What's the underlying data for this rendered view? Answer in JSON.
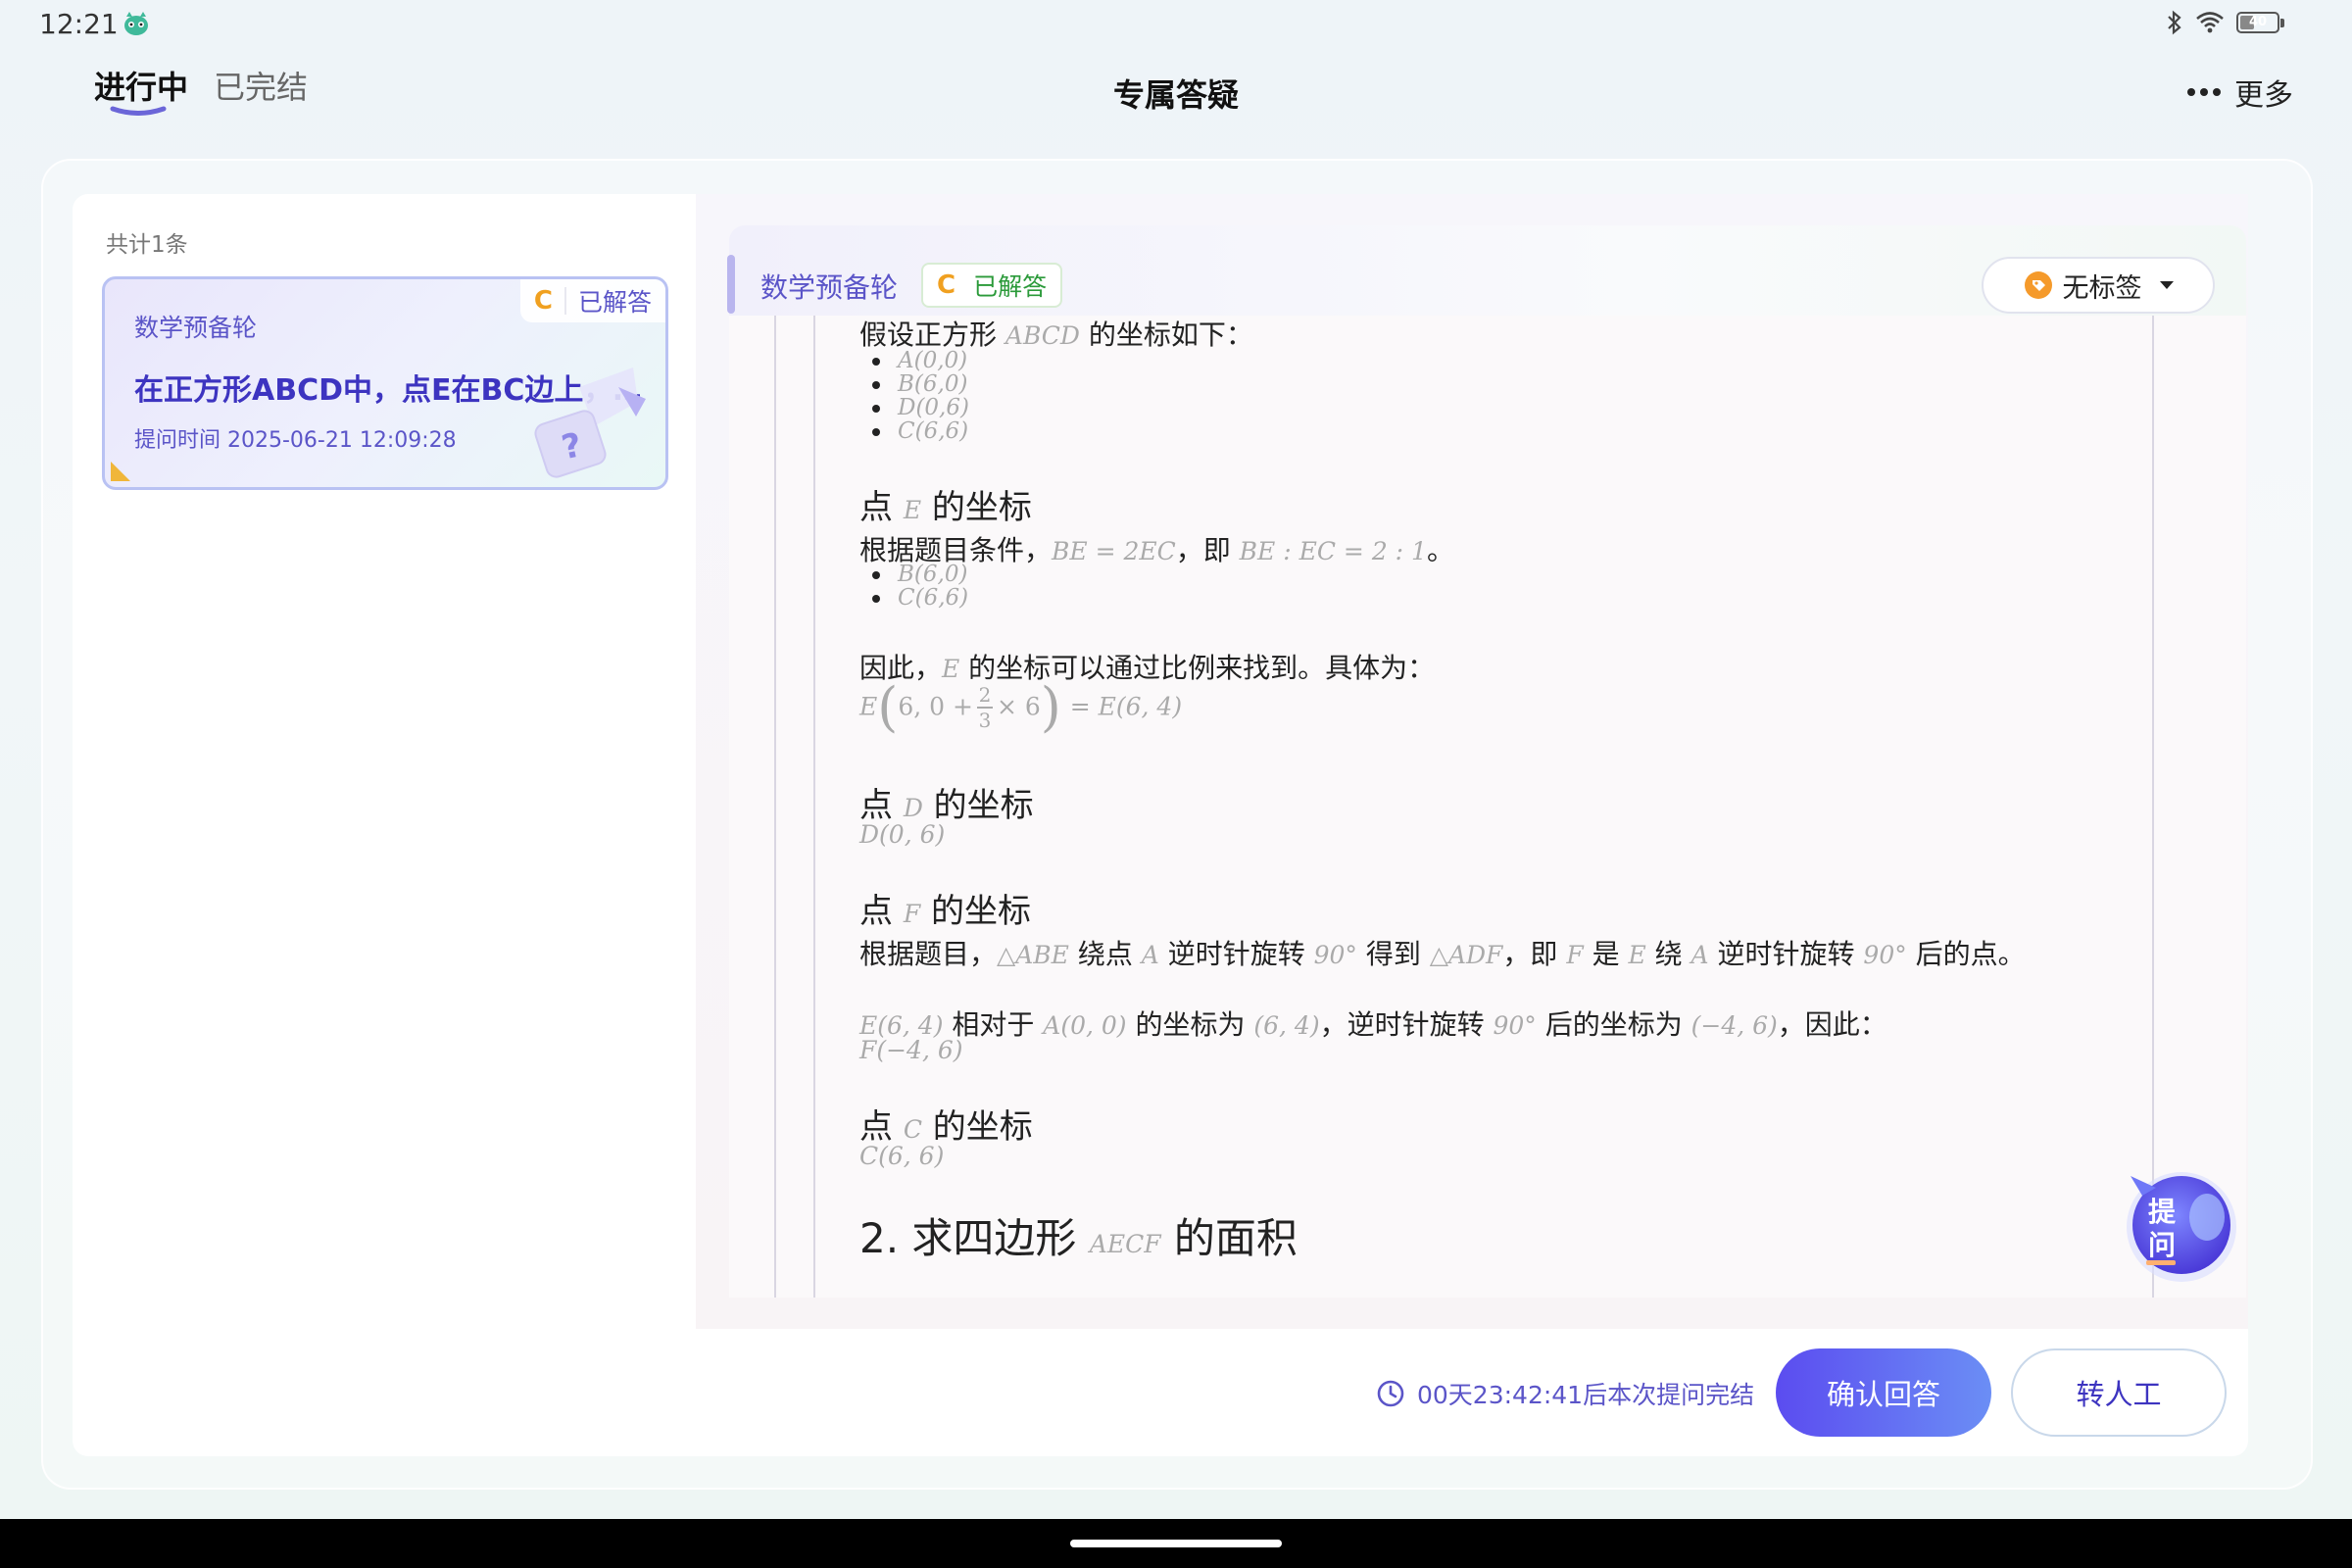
{
  "status_bar": {
    "time": "12:21",
    "battery": "40",
    "battery_level": 0.4
  },
  "header": {
    "tabs": [
      {
        "label": "进行中",
        "active": true
      },
      {
        "label": "已完结",
        "active": false
      }
    ],
    "title": "专属答疑",
    "more_label": "更多"
  },
  "list": {
    "count_label": "共计1条",
    "items": [
      {
        "subject": "数学预备轮",
        "grade_letter": "C",
        "status": "已解答",
        "title": "在正方形ABCD中，点E在BC边上，点F在CD边上",
        "time": "提问时间 2025-06-21 12:09:28"
      }
    ]
  },
  "detail": {
    "subject": "数学预备轮",
    "grade_letter": "C",
    "status": "已解答",
    "tag_label": "无标签",
    "answer": {
      "intro_pre": "假设正方形 ",
      "intro_math": "ABCD",
      "intro_post": " 的坐标如下：",
      "coords": [
        "A(0,0)",
        "B(6,0)",
        "D(0,6)",
        "C(6,6)"
      ],
      "e_heading_pre": "点 ",
      "e_heading_math": "E",
      "e_heading_post": " 的坐标",
      "e_text_pre": "根据题目条件，",
      "e_text_m1": "BE = 2EC",
      "e_text_mid": "，即 ",
      "e_text_m2": "BE : EC = 2 : 1",
      "e_text_post": "。",
      "e_coords": [
        "B(6,0)",
        "C(6,6)"
      ],
      "e_ratio_pre": "因此，",
      "e_ratio_math": "E",
      "e_ratio_post": " 的坐标可以通过比例来找到。具体为：",
      "e_formula_a": "E",
      "e_formula_b": "6, 0 +",
      "e_formula_num": "2",
      "e_formula_den": "3",
      "e_formula_c": "× 6",
      "e_formula_d": "= E(6, 4)",
      "d_heading_pre": "点 ",
      "d_heading_math": "D",
      "d_heading_post": " 的坐标",
      "d_value": "D(0, 6)",
      "f_heading_pre": "点 ",
      "f_heading_math": "F",
      "f_heading_post": " 的坐标",
      "f_text": [
        {
          "t": "根据题目，"
        },
        {
          "m": "△ABE"
        },
        {
          "t": " 绕点 "
        },
        {
          "m": "A"
        },
        {
          "t": " 逆时针旋转 "
        },
        {
          "m": "90°"
        },
        {
          "t": " 得到 "
        },
        {
          "m": "△ADF"
        },
        {
          "t": "，即 "
        },
        {
          "m": "F"
        },
        {
          "t": " 是 "
        },
        {
          "m": "E"
        },
        {
          "t": " 绕 "
        },
        {
          "m": "A"
        },
        {
          "t": " 逆时针旋转 "
        },
        {
          "m": "90°"
        },
        {
          "t": " 后的点。"
        }
      ],
      "f_text2": [
        {
          "m": "E(6, 4)"
        },
        {
          "t": " 相对于 "
        },
        {
          "m": "A(0, 0)"
        },
        {
          "t": " 的坐标为 "
        },
        {
          "m": "(6, 4)"
        },
        {
          "t": "，逆时针旋转 "
        },
        {
          "m": "90°"
        },
        {
          "t": " 后的坐标为 "
        },
        {
          "m": "(−4, 6)"
        },
        {
          "t": "，因此："
        }
      ],
      "f_value": "F(−4, 6)",
      "c_heading_pre": "点 ",
      "c_heading_math": "C",
      "c_heading_post": " 的坐标",
      "c_value": "C(6, 6)",
      "area_heading_pre": "2. 求四边形 ",
      "area_heading_math": "AECF",
      "area_heading_post": " 的面积"
    }
  },
  "footer": {
    "countdown": "00天23:42:41后本次提问完结",
    "confirm_label": "确认回答",
    "human_label": "转人工"
  },
  "fab": {
    "label_top": "提",
    "label_bottom": "问"
  },
  "colors": {
    "accent": "#5b55c8",
    "primary_button": "#5b4cf0",
    "answered_green": "#2b9a3a",
    "grade_orange": "#f0a020"
  }
}
